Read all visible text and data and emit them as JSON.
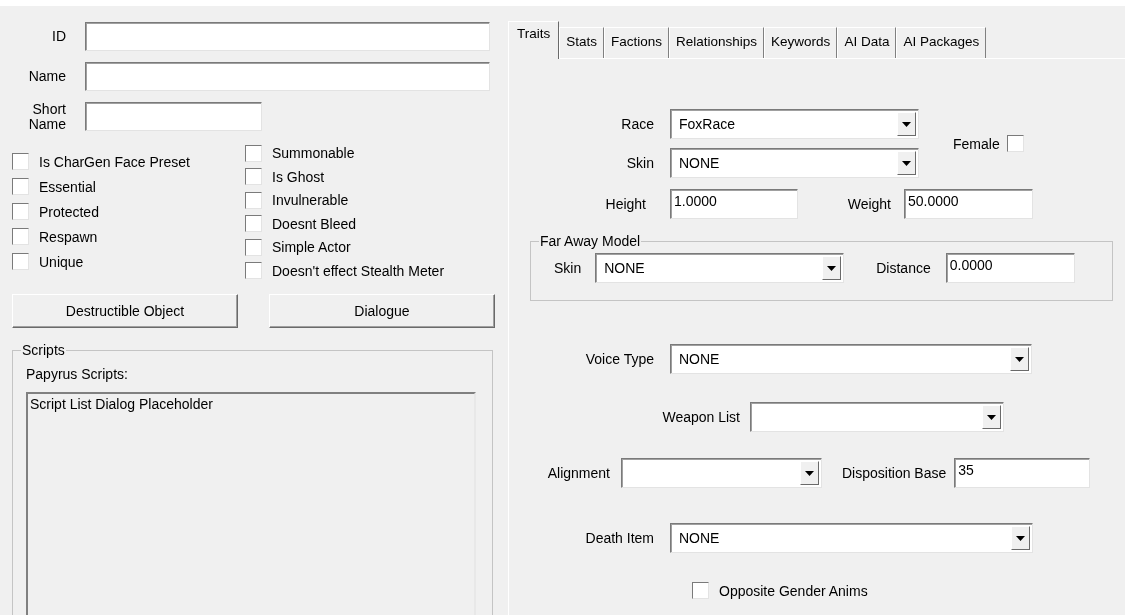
{
  "record_fields": [
    {
      "label": "ID",
      "kind": "long"
    },
    {
      "label": "Name",
      "kind": "long"
    },
    {
      "label": "Short Name",
      "kind": "short"
    }
  ],
  "flag_columns": [
    [
      {
        "label": "Is CharGen Face Preset",
        "checked": false
      },
      {
        "label": "Essential",
        "checked": false
      },
      {
        "label": "Protected",
        "checked": false
      },
      {
        "label": "Respawn",
        "checked": false
      },
      {
        "label": "Unique",
        "checked": false
      }
    ],
    [
      {
        "label": "Summonable",
        "checked": false
      },
      {
        "label": "Is Ghost",
        "checked": false
      },
      {
        "label": "Invulnerable",
        "checked": false
      },
      {
        "label": "Doesnt Bleed",
        "checked": false
      },
      {
        "label": "Simple Actor",
        "checked": false
      },
      {
        "label": "Doesn't effect Stealth Meter",
        "checked": false
      }
    ]
  ],
  "buttons": [
    "Destructible Object",
    "Dialogue"
  ],
  "scripts": {
    "title": "Scripts",
    "label": "Papyrus Scripts:",
    "items": [
      "Script List Dialog Placeholder"
    ]
  },
  "tabs": [
    {
      "label": "Traits",
      "selected": true
    },
    {
      "label": "Stats",
      "selected": false
    },
    {
      "label": "Factions",
      "selected": false
    },
    {
      "label": "Relationships",
      "selected": false
    },
    {
      "label": "Keywords",
      "selected": false
    },
    {
      "label": "AI Data",
      "selected": false
    },
    {
      "label": "AI Packages",
      "selected": false
    }
  ],
  "traits": {
    "race": {
      "label": "Race",
      "value": "FoxRace"
    },
    "skin": {
      "label": "Skin",
      "value": "NONE"
    },
    "female": {
      "label": "Female",
      "checked": false
    },
    "height": {
      "label": "Height",
      "value": "1.0000"
    },
    "weight": {
      "label": "Weight",
      "value": "50.0000"
    },
    "far_away_model": {
      "title": "Far Away Model",
      "skin": {
        "label": "Skin",
        "value": "NONE"
      },
      "distance": {
        "label": "Distance",
        "value": "0.0000"
      }
    },
    "voice_type": {
      "label": "Voice Type",
      "value": "NONE"
    },
    "weapon_list": {
      "label": "Weapon List"
    },
    "alignment": {
      "label": "Alignment"
    },
    "disposition_base": {
      "label": "Disposition Base",
      "value": "35"
    },
    "death_item": {
      "label": "Death Item",
      "value": "NONE"
    },
    "opposite_gender_anims": {
      "label": "Opposite Gender Anims",
      "checked": false
    }
  }
}
